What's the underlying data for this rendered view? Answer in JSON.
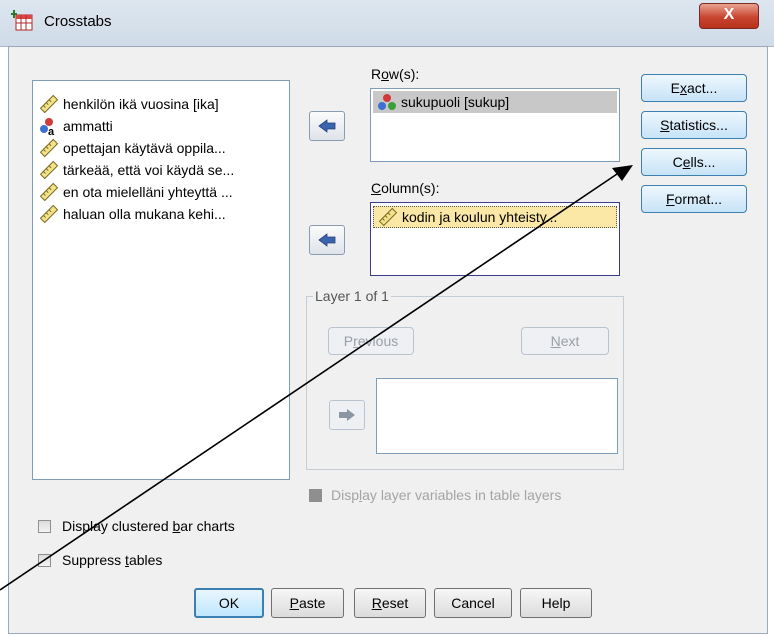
{
  "window": {
    "title": "Crosstabs",
    "close_label": "X"
  },
  "variables": {
    "items": [
      {
        "label": "henkilön ikä vuosina [ika]",
        "icon": "scale-ruler-icon"
      },
      {
        "label": "ammatti",
        "icon": "nominal-balls-icon"
      },
      {
        "label": "opettajan käytävä oppila...",
        "icon": "scale-ruler-icon"
      },
      {
        "label": "tärkeää, että voi käydä se...",
        "icon": "scale-ruler-icon"
      },
      {
        "label": "en ota mielelläni yhteyttä ...",
        "icon": "scale-ruler-icon"
      },
      {
        "label": "haluan olla mukana kehi...",
        "icon": "scale-ruler-icon"
      }
    ]
  },
  "rows": {
    "pre": "R",
    "mnemonic": "o",
    "post": "w(s):",
    "items": [
      {
        "label": "sukupuoli [sukup]",
        "icon": "nominal-balls-icon"
      }
    ]
  },
  "columns": {
    "pre": "",
    "mnemonic": "C",
    "post": "olumn(s):",
    "items": [
      {
        "label": "kodin ja koulun yhteisty...",
        "icon": "scale-ruler-icon"
      }
    ]
  },
  "layer": {
    "label": "Layer 1 of 1",
    "previous": {
      "pre": "P",
      "mnemonic": "r",
      "post": "evious"
    },
    "next": {
      "pre": "",
      "mnemonic": "N",
      "post": "ext"
    }
  },
  "side_buttons": {
    "exact": {
      "pre": "E",
      "mnemonic": "x",
      "post": "act..."
    },
    "statistics": {
      "pre": "",
      "mnemonic": "S",
      "post": "tatistics..."
    },
    "cells": {
      "pre": "C",
      "mnemonic": "e",
      "post": "lls..."
    },
    "format": {
      "pre": "",
      "mnemonic": "F",
      "post": "ormat..."
    }
  },
  "options": {
    "display_layer": {
      "pre": "Disp",
      "mnemonic": "l",
      "post": "ay layer variables in table layers",
      "checked": false,
      "enabled": false
    },
    "clustered_bar": {
      "pre": "Display clustered ",
      "mnemonic": "b",
      "post": "ar charts",
      "checked": false
    },
    "suppress": {
      "pre": "Suppress ",
      "mnemonic": "t",
      "post": "ables",
      "checked": false
    }
  },
  "bottom_buttons": {
    "ok": {
      "pre": "OK",
      "mnemonic": "",
      "post": ""
    },
    "paste": {
      "pre": "",
      "mnemonic": "P",
      "post": "aste"
    },
    "reset": {
      "pre": "",
      "mnemonic": "R",
      "post": "eset"
    },
    "cancel": {
      "pre": "Cancel",
      "mnemonic": "",
      "post": ""
    },
    "help": {
      "pre": "Help",
      "mnemonic": "",
      "post": ""
    }
  },
  "colors": {
    "selected_row_bg": "#c8c8c8",
    "selected_column_bg": "#fbe7a6",
    "arrow_blue": "#3a64b0",
    "annotation_line": "#000000"
  }
}
